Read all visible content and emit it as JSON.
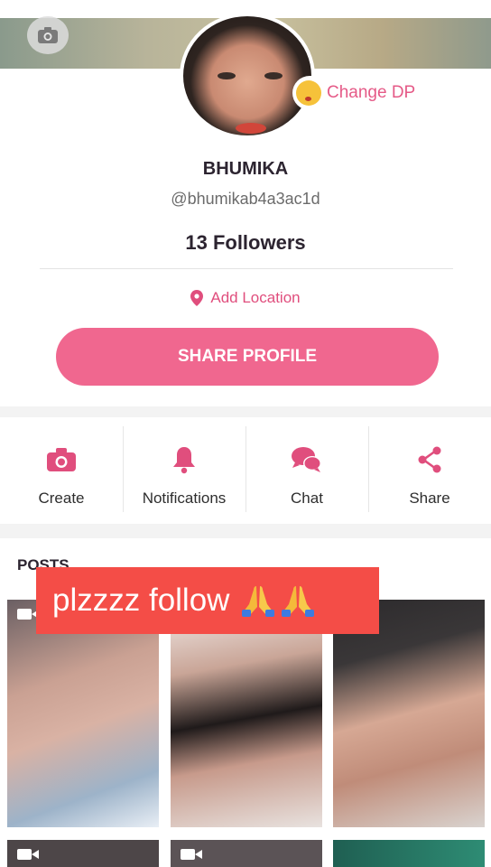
{
  "header": {
    "camera_icon": "camera-icon"
  },
  "profile": {
    "change_dp_label": "Change DP",
    "change_dp_icon": "kissing-face-emoji-icon",
    "name": "BHUMIKA",
    "handle": "@bhumikab4a3ac1d",
    "followers": "13 Followers",
    "location_label": "Add Location",
    "location_icon": "location-pin-icon",
    "share_label": "SHARE PROFILE"
  },
  "actions": [
    {
      "label": "Create",
      "icon": "camera-icon"
    },
    {
      "label": "Notifications",
      "icon": "bell-icon"
    },
    {
      "label": "Chat",
      "icon": "chat-bubbles-icon"
    },
    {
      "label": "Share",
      "icon": "share-icon"
    }
  ],
  "posts": {
    "title": "POSTS",
    "video_icon": "video-camera-icon"
  },
  "overlay": {
    "text": "plzzzz follow",
    "emoji": "folded-hands-emoji-icon"
  },
  "colors": {
    "accent": "#f0678f",
    "accent_text": "#e04e7d",
    "overlay_bg": "#f44d47"
  }
}
